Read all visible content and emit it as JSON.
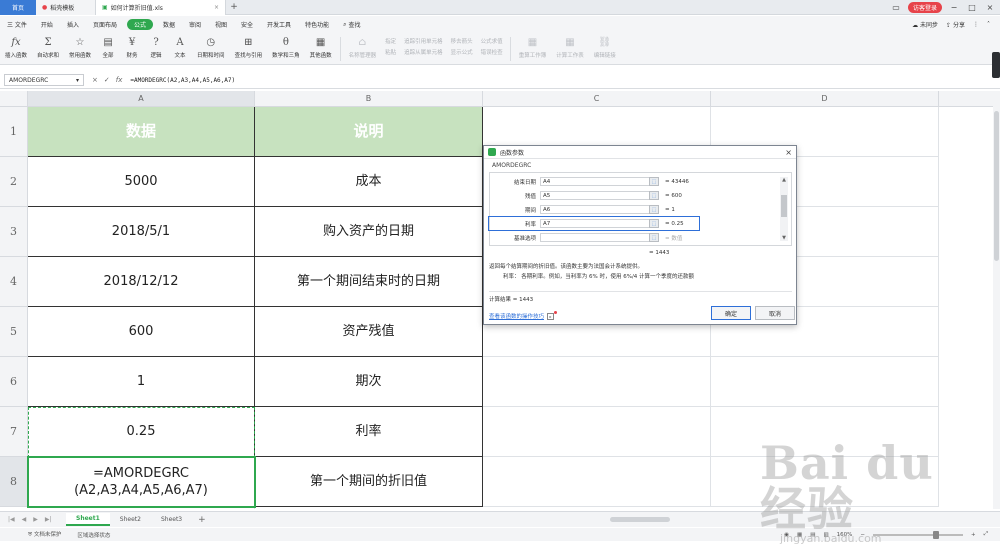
{
  "titlebar": {
    "home_tab": "首页",
    "templates_tab": "稻壳模板",
    "doc_tab": "如何计算折旧值.xls",
    "login_button": "访客登录"
  },
  "menu": {
    "file": "三 文件",
    "items": [
      "开始",
      "插入",
      "页面布局",
      "公式",
      "数据",
      "审阅",
      "视图",
      "安全",
      "开发工具",
      "特色功能"
    ],
    "active": "公式",
    "search": "查找",
    "sync": "未同步",
    "share": "分享"
  },
  "ribbon": {
    "buttons": [
      "插入函数",
      "自动求和",
      "常用函数",
      "全部",
      "财务",
      "逻辑",
      "文本",
      "日期和时间",
      "查找与引用",
      "数学和三角",
      "其他函数"
    ],
    "disabled_buttons": [
      "名称管理器",
      "粘贴"
    ],
    "small_top": [
      "指定",
      "追踪引用单元格",
      "移去箭头",
      "公式求值"
    ],
    "small_bottom": [
      "追踪从属单元格",
      "显示公式",
      "错误检查"
    ],
    "disabled_right": [
      "重算工作簿",
      "计算工作表",
      "编辑链接"
    ]
  },
  "formulabar": {
    "namebox": "AMORDEGRC",
    "cancel": "×",
    "confirm": "✓",
    "fx": "fx",
    "formula": "=AMORDEGRC(A2,A3,A4,A5,A6,A7)"
  },
  "columns": [
    "A",
    "B",
    "C",
    "D"
  ],
  "rows": [
    {
      "num": "1",
      "a": "数据",
      "b": "说明"
    },
    {
      "num": "2",
      "a": "5000",
      "b": "成本"
    },
    {
      "num": "3",
      "a": "2018/5/1",
      "b": "购入资产的日期"
    },
    {
      "num": "4",
      "a": "2018/12/12",
      "b": "第一个期间结束时的日期"
    },
    {
      "num": "5",
      "a": "600",
      "b": "资产残值"
    },
    {
      "num": "6",
      "a": "1",
      "b": "期次"
    },
    {
      "num": "7",
      "a": "0.25",
      "b": "利率"
    },
    {
      "num": "8",
      "a": "=AMORDEGRC\n(A2,A3,A4,A5,A6,A7)",
      "b": "第一个期间的折旧值"
    }
  ],
  "sheets": [
    "Sheet1",
    "Sheet2",
    "Sheet3"
  ],
  "active_sheet": "Sheet1",
  "status": {
    "protect": "文档未保护",
    "mode": "区域选择状态",
    "zoom": "160%"
  },
  "dialog": {
    "title": "函数参数",
    "function_name": "AMORDEGRC",
    "params": [
      {
        "label": "结束日期",
        "value": "A4",
        "result": "= 43446",
        "gray": false
      },
      {
        "label": "残值",
        "value": "A5",
        "result": "= 600",
        "gray": false
      },
      {
        "label": "期间",
        "value": "A6",
        "result": "= 1",
        "gray": false
      },
      {
        "label": "利率",
        "value": "A7",
        "result": "= 0.25",
        "gray": false
      },
      {
        "label": "基准选项",
        "value": "",
        "result": "= 数值",
        "gray": true
      }
    ],
    "total": "= 1443",
    "description": "返回每个结算期间的折旧值。该函数主要为法国会计系统提供。",
    "arg_desc": "利率： 各期利率。例如，当利率为 6% 时，使用 6%/4 计算一个季度的还款额",
    "calc_result": "计算结果 = 1443",
    "help_link": "查看该函数的操作技巧",
    "ok": "确定",
    "cancel": "取消"
  },
  "watermark": {
    "main": "Bai du 经验",
    "url": "jingyan.baidu.com"
  },
  "colors": {
    "accent": "#2fa84f",
    "header_fill": "#c7e2bf",
    "focus_blue": "#2e6fd8"
  }
}
